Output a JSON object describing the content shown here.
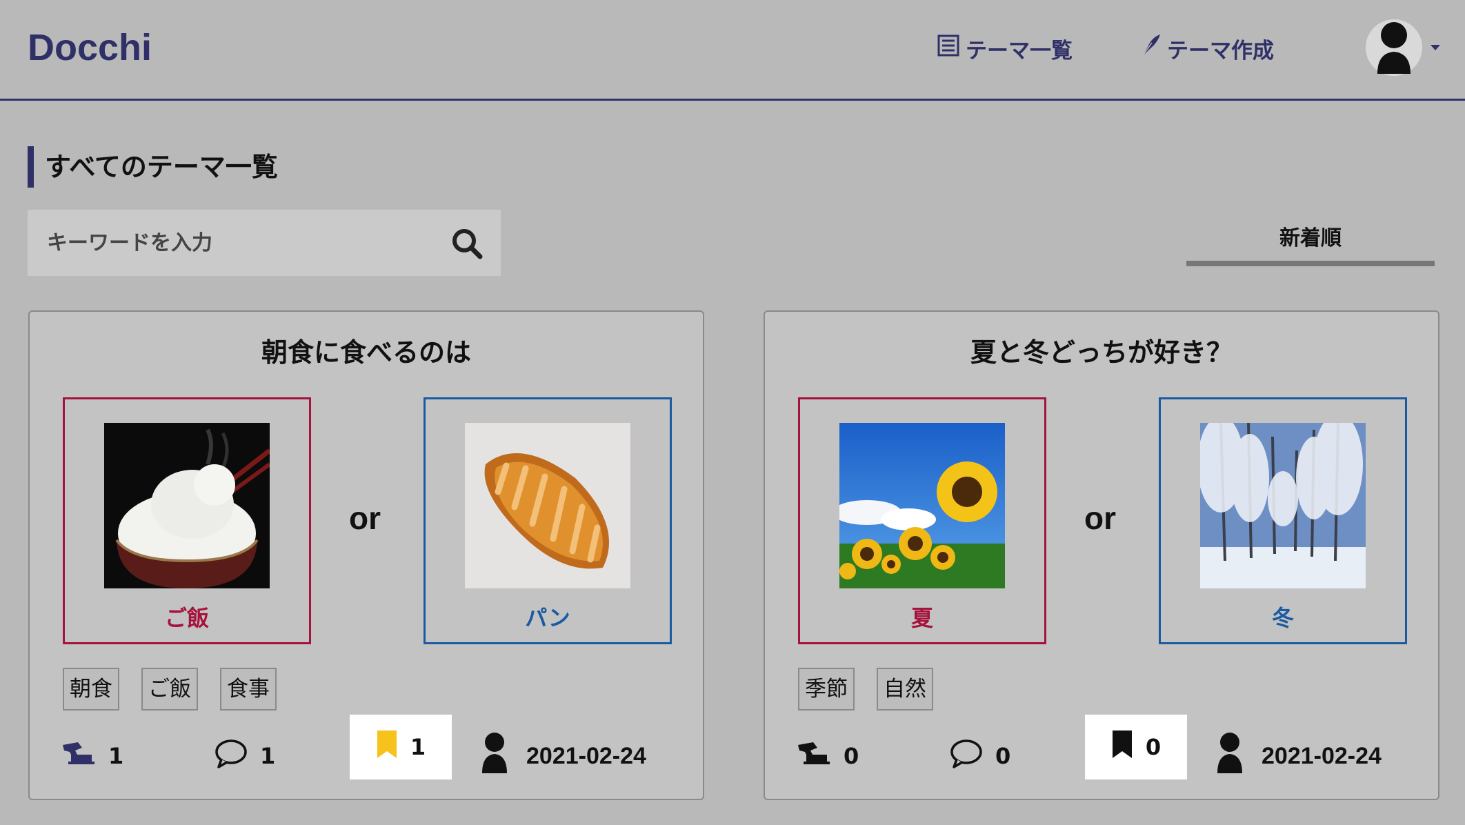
{
  "header": {
    "logo": "Docchi",
    "nav": [
      {
        "label": "テーマ一覧",
        "icon": "list-icon"
      },
      {
        "label": "テーマ作成",
        "icon": "feather-icon"
      }
    ],
    "user_icon": "user-avatar-icon"
  },
  "page_title": "すべてのテーマ一覧",
  "search": {
    "placeholder": "キーワードを入力",
    "value": "",
    "icon": "search-icon"
  },
  "sort": {
    "selected": "新着順"
  },
  "colors": {
    "accent": "#2f3068",
    "option_a": "#a5123b",
    "option_b": "#1a5aa0",
    "bookmark_active": "#f6c21c"
  },
  "themes": [
    {
      "title": "朝食に食べるのは",
      "option_a": {
        "label": "ご飯",
        "image": "rice-bowl-image"
      },
      "option_b": {
        "label": "パン",
        "image": "bread-image"
      },
      "or": "or",
      "tags": [
        "朝食",
        "ご飯",
        "食事"
      ],
      "votes": "1",
      "comments": "1",
      "bookmarks": "1",
      "bookmarked": true,
      "date": "2021-02-24"
    },
    {
      "title": "夏と冬どっちが好き？",
      "option_a": {
        "label": "夏",
        "image": "sunflower-image"
      },
      "option_b": {
        "label": "冬",
        "image": "snowy-trees-image"
      },
      "or": "or",
      "tags": [
        "季節",
        "自然"
      ],
      "votes": "0",
      "comments": "0",
      "bookmarks": "0",
      "bookmarked": false,
      "date": "2021-02-24"
    }
  ]
}
